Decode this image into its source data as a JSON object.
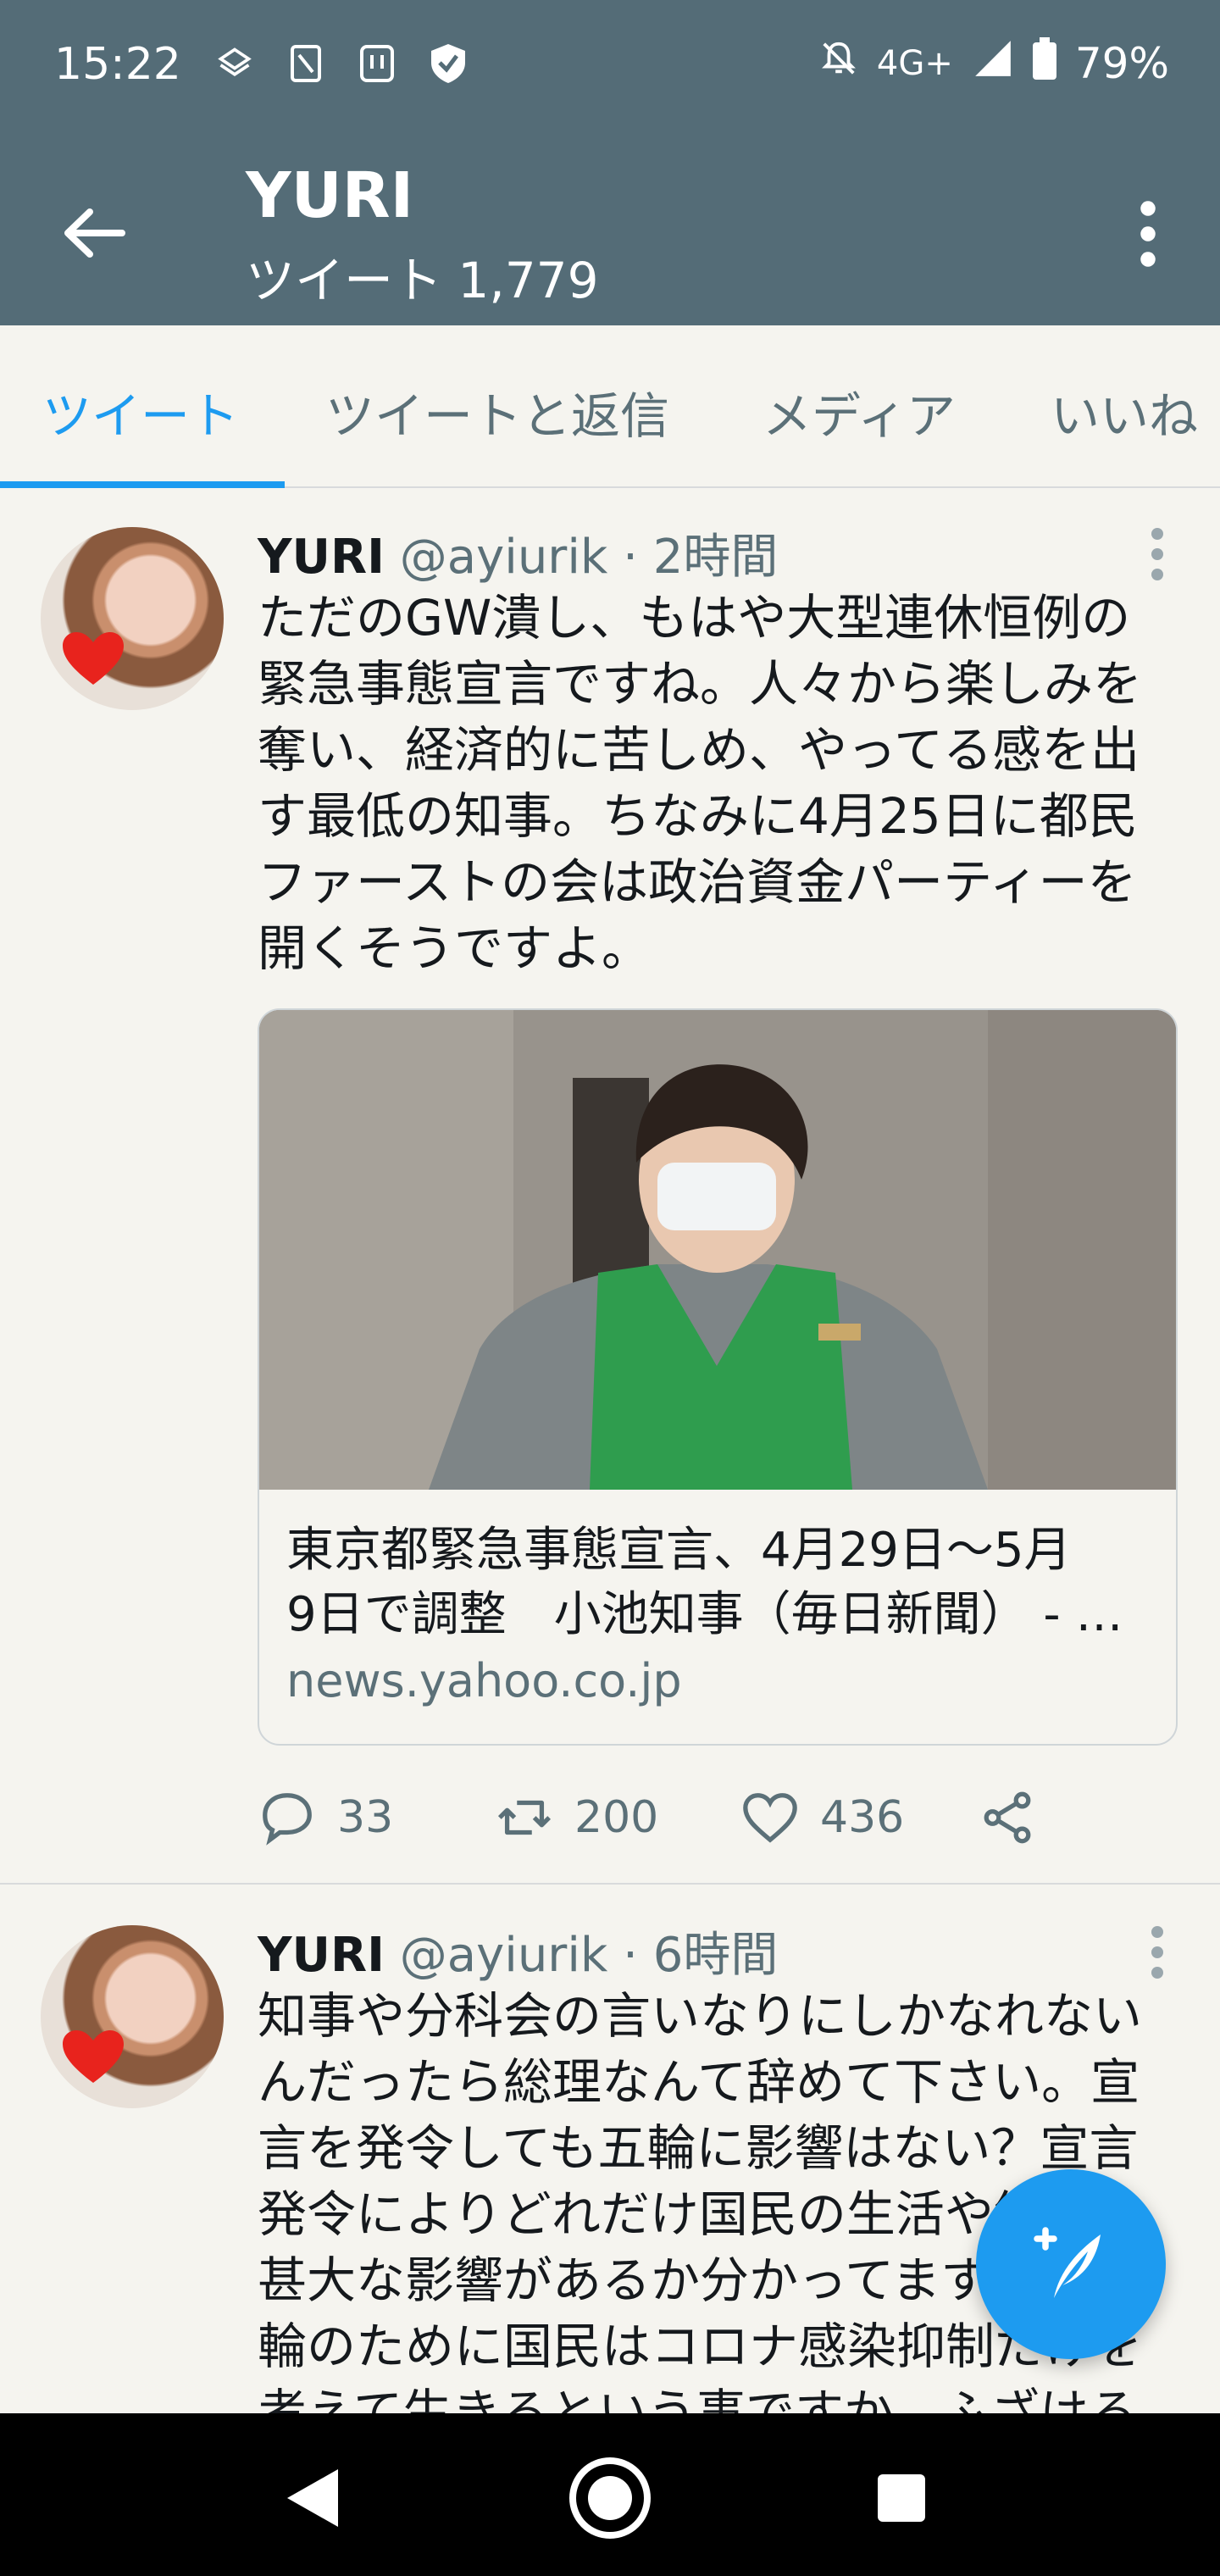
{
  "status_bar": {
    "time": "15:22",
    "network": "4G+",
    "battery": "79%",
    "icons": [
      "archive-icon",
      "sim-icon",
      "hands-icon",
      "shield-icon",
      "bell-off-icon",
      "signal-icon",
      "battery-icon"
    ]
  },
  "app_bar": {
    "title": "YURI",
    "subtitle": "ツイート 1,779"
  },
  "tabs": [
    {
      "label": "ツイート",
      "active": true
    },
    {
      "label": "ツイートと返信",
      "active": false
    },
    {
      "label": "メディア",
      "active": false
    },
    {
      "label": "いいね",
      "active": false
    }
  ],
  "tweets": [
    {
      "name": "YURI",
      "meta": "@ayiurik · 2時間",
      "text_lines": [
        "ただのGW潰し、もはや大型連休恒例の",
        "緊急事態宣言ですね。人々から楽しみを",
        "奪い、経済的に苦しめ、やってる感を出",
        "す最低の知事。ちなみに4月25日に都民",
        "ファーストの会は政治資金パーティーを",
        "開くそうですよ。"
      ],
      "card": {
        "title_line1": "東京都緊急事態宣言、4月29日～5月",
        "title_line2": "9日で調整　小池知事（毎日新聞） - …",
        "domain": "news.yahoo.co.jp"
      },
      "actions": {
        "reply": "33",
        "retweet": "200",
        "like": "436"
      }
    },
    {
      "name": "YURI",
      "meta": "@ayiurik · 6時間",
      "text_lines": [
        "知事や分科会の言いなりにしかなれない",
        "んだったら総理なんて辞めて下さい。宣",
        "言を発令しても五輪に影響はない？宣言",
        "発令によりどれだけ国民の生活や経済に",
        "甚大な影響があるか分かってますか？五",
        "輪のために国民はコロナ感染抑制だけを",
        "考えて生きるという事ですか。ふざける"
      ]
    }
  ],
  "colors": {
    "header": "#546c77",
    "accent": "#1d9bf0",
    "background": "#f5f4ef",
    "muted": "#5b7078"
  }
}
